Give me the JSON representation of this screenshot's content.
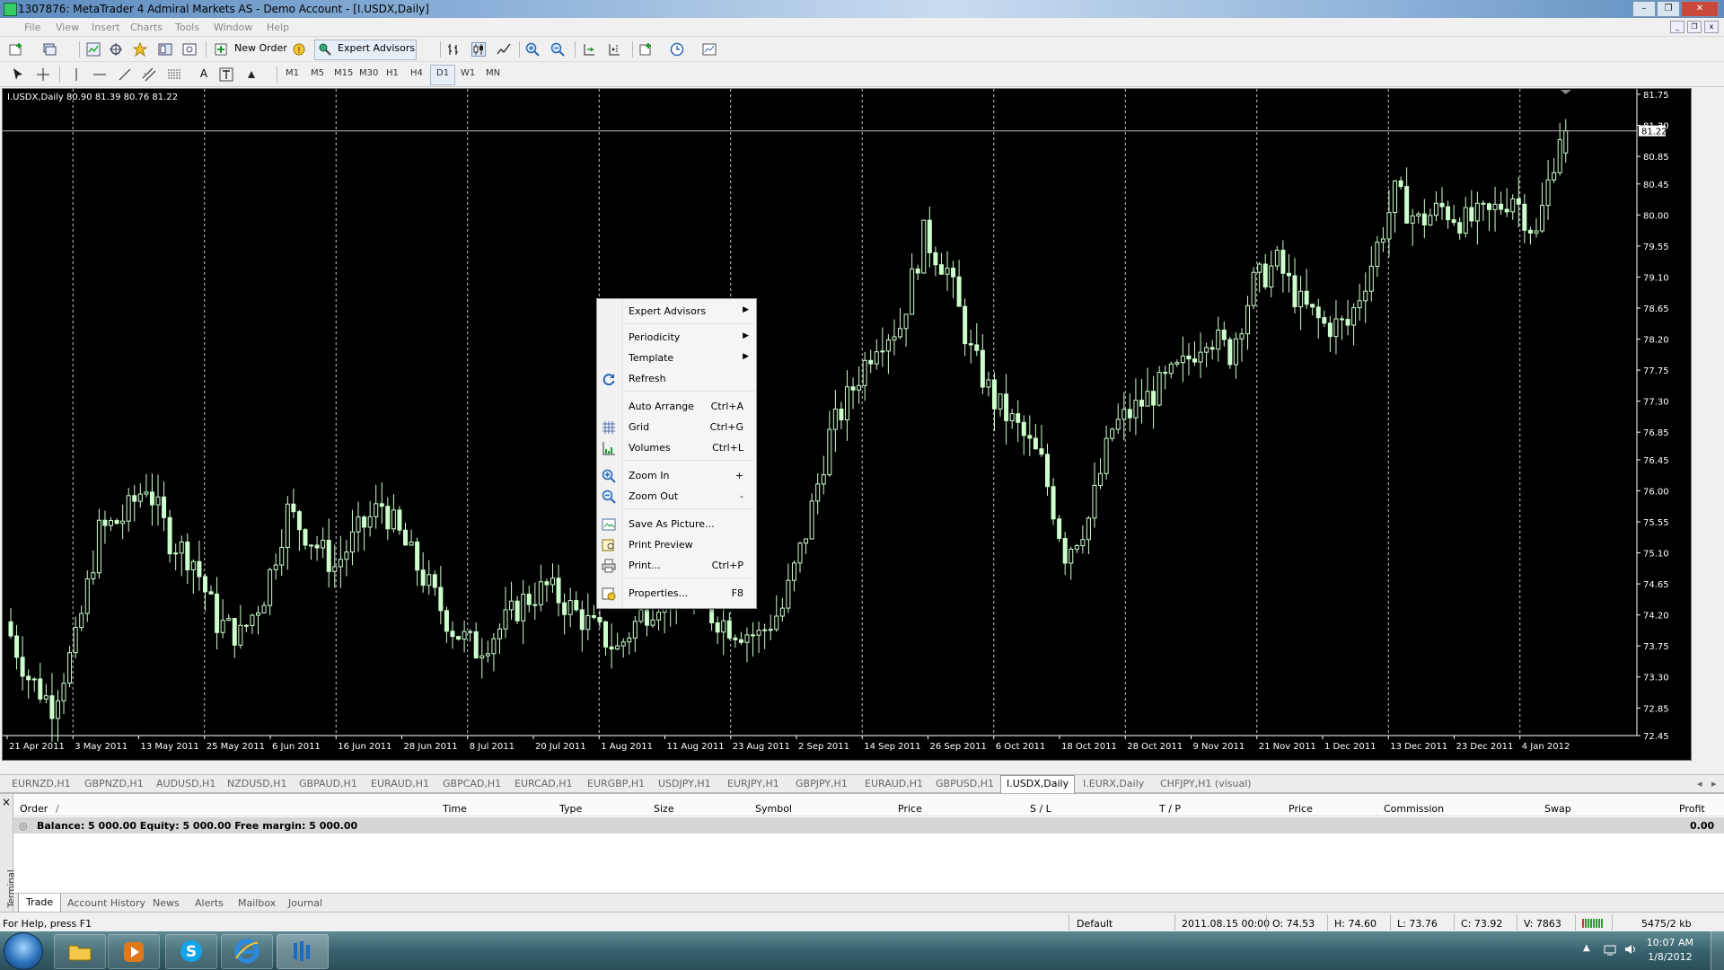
{
  "window": {
    "title": "1307876: MetaTrader 4 Admiral Markets AS - Demo Account - [I.USDX,Daily]",
    "controls": [
      "–",
      "❐",
      "✕"
    ]
  },
  "menu": [
    "File",
    "View",
    "Insert",
    "Charts",
    "Tools",
    "Window",
    "Help"
  ],
  "toolbar": {
    "new_order_label": "New Order",
    "expert_advisors_label": "Expert Advisors",
    "timeframes": [
      "M1",
      "M5",
      "M15",
      "M30",
      "H1",
      "H4",
      "D1",
      "W1",
      "MN"
    ],
    "active_timeframe": "D1"
  },
  "chart": {
    "info": "I.USDX,Daily  80.90 81.39 80.76 81.22",
    "current_price_label": "81.22",
    "background_color": "#000000",
    "candle_color": "#ccffcc",
    "grid": true
  },
  "chart_data": {
    "type": "candlestick",
    "symbol": "I.USDX",
    "timeframe": "Daily",
    "ohlc_last": {
      "open": 80.9,
      "high": 81.39,
      "low": 80.76,
      "close": 81.22
    },
    "y_ticks": [
      "81.75",
      "81.30",
      "80.85",
      "80.45",
      "80.00",
      "79.55",
      "79.10",
      "78.65",
      "78.20",
      "77.75",
      "77.30",
      "76.85",
      "76.45",
      "76.00",
      "75.55",
      "75.10",
      "74.65",
      "74.20",
      "73.75",
      "73.30",
      "72.85",
      "72.45"
    ],
    "ylim": [
      72.45,
      81.75
    ],
    "x_ticks": [
      "21 Apr 2011",
      "3 May 2011",
      "13 May 2011",
      "25 May 2011",
      "6 Jun 2011",
      "16 Jun 2011",
      "28 Jun 2011",
      "8 Jul 2011",
      "20 Jul 2011",
      "1 Aug 2011",
      "11 Aug 2011",
      "23 Aug 2011",
      "2 Sep 2011",
      "14 Sep 2011",
      "26 Sep 2011",
      "6 Oct 2011",
      "18 Oct 2011",
      "28 Oct 2011",
      "9 Nov 2011",
      "21 Nov 2011",
      "1 Dec 2011",
      "13 Dec 2011",
      "23 Dec 2011",
      "4 Jan 2012"
    ],
    "close_path": [
      74.1,
      73.3,
      72.9,
      73.8,
      75.4,
      75.6,
      76.1,
      75.3,
      75.0,
      74.1,
      73.9,
      74.5,
      75.7,
      75.3,
      74.9,
      75.4,
      75.8,
      75.2,
      74.6,
      74.0,
      73.7,
      74.0,
      74.4,
      74.6,
      74.3,
      74.0,
      73.7,
      74.2,
      74.5,
      74.4,
      74.2,
      74.0,
      73.9,
      74.3,
      75.4,
      76.8,
      77.5,
      78.2,
      78.4,
      79.7,
      79.2,
      78.0,
      77.3,
      76.9,
      76.4,
      75.1,
      75.6,
      76.9,
      77.2,
      77.5,
      77.8,
      78.3,
      78.0,
      79.0,
      79.3,
      78.7,
      78.4,
      78.4,
      79.3,
      80.3,
      79.9,
      80.1,
      79.9,
      80.0,
      80.3,
      79.7,
      81.2
    ]
  },
  "chart_tabs": [
    "EURNZD,H1",
    "GBPNZD,H1",
    "AUDUSD,H1",
    "NZDUSD,H1",
    "GBPAUD,H1",
    "EURAUD,H1",
    "GBPCAD,H1",
    "EURCAD,H1",
    "EURGBP,H1",
    "USDJPY,H1",
    "EURJPY,H1",
    "GBPJPY,H1",
    "EURAUD,H1",
    "GBPUSD,H1",
    "I.USDX,Daily",
    "I.EURX,Daily",
    "CHFJPY,H1 (visual)"
  ],
  "active_chart_tab": "I.USDX,Daily",
  "context_menu": {
    "items": [
      {
        "label": "Expert Advisors",
        "shortcut": "",
        "submenu": true,
        "icon": ""
      },
      {
        "label": "Periodicity",
        "shortcut": "",
        "submenu": true,
        "icon": ""
      },
      {
        "label": "Template",
        "shortcut": "",
        "submenu": true,
        "icon": ""
      },
      {
        "label": "Refresh",
        "shortcut": "",
        "submenu": false,
        "icon": "refresh-icon"
      },
      {
        "label": "Auto Arrange",
        "shortcut": "Ctrl+A",
        "submenu": false,
        "icon": ""
      },
      {
        "label": "Grid",
        "shortcut": "Ctrl+G",
        "submenu": false,
        "icon": "grid-icon"
      },
      {
        "label": "Volumes",
        "shortcut": "Ctrl+L",
        "submenu": false,
        "icon": "volumes-icon"
      },
      {
        "label": "Zoom In",
        "shortcut": "+",
        "submenu": false,
        "icon": "zoom-in-icon"
      },
      {
        "label": "Zoom Out",
        "shortcut": "-",
        "submenu": false,
        "icon": "zoom-out-icon"
      },
      {
        "label": "Save As Picture...",
        "shortcut": "",
        "submenu": false,
        "icon": "save-picture-icon"
      },
      {
        "label": "Print Preview",
        "shortcut": "",
        "submenu": false,
        "icon": "print-preview-icon"
      },
      {
        "label": "Print...",
        "shortcut": "Ctrl+P",
        "submenu": false,
        "icon": "print-icon"
      },
      {
        "label": "Properties...",
        "shortcut": "F8",
        "submenu": false,
        "icon": "properties-icon"
      }
    ]
  },
  "terminal": {
    "side_label": "Terminal",
    "close": "×",
    "columns": [
      "Order",
      "/",
      "Time",
      "Type",
      "Size",
      "Symbol",
      "Price",
      "S / L",
      "T / P",
      "Price",
      "Commission",
      "Swap",
      "Profit"
    ],
    "balance_text": "Balance: 5 000.00  Equity: 5 000.00  Free margin: 5 000.00",
    "profit_total": "0.00",
    "tabs": [
      "Trade",
      "Account History",
      "News",
      "Alerts",
      "Mailbox",
      "Journal"
    ],
    "active_tab": "Trade"
  },
  "status": {
    "help": "For Help, press F1",
    "profile": "Default",
    "datetime": "2011.08.15 00:00",
    "open": "O: 74.53",
    "high": "H: 74.60",
    "low": "L: 73.76",
    "close": "C: 73.92",
    "volume": "V: 7863",
    "traffic": "5475/2 kb"
  },
  "taskbar": {
    "time": "10:07 AM",
    "date": "1/8/2012",
    "apps": [
      "explorer-icon",
      "media-player-icon",
      "skype-icon",
      "internet-explorer-icon",
      "metatrader-icon"
    ]
  }
}
